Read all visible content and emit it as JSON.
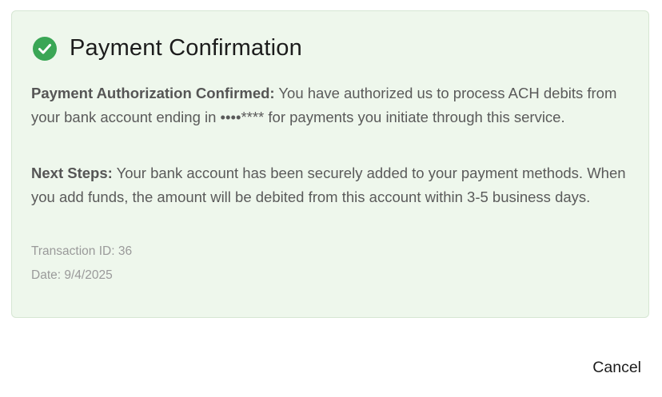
{
  "confirmation": {
    "title": "Payment Confirmation",
    "authorization": {
      "label": "Payment Authorization Confirmed:",
      "text": " You have authorized us to process ACH debits from your bank account ending in ••••**** for payments you initiate through this service."
    },
    "next_steps": {
      "label": "Next Steps:",
      "text": " Your bank account has been securely added to your payment methods. When you add funds, the amount will be debited from this account within 3-5 business days."
    },
    "transaction_id": "Transaction ID: 36",
    "date": "Date: 9/4/2025",
    "icon": "check-circle-icon",
    "accent_color": "#3aa655"
  },
  "footer": {
    "cancel_label": "Cancel"
  }
}
